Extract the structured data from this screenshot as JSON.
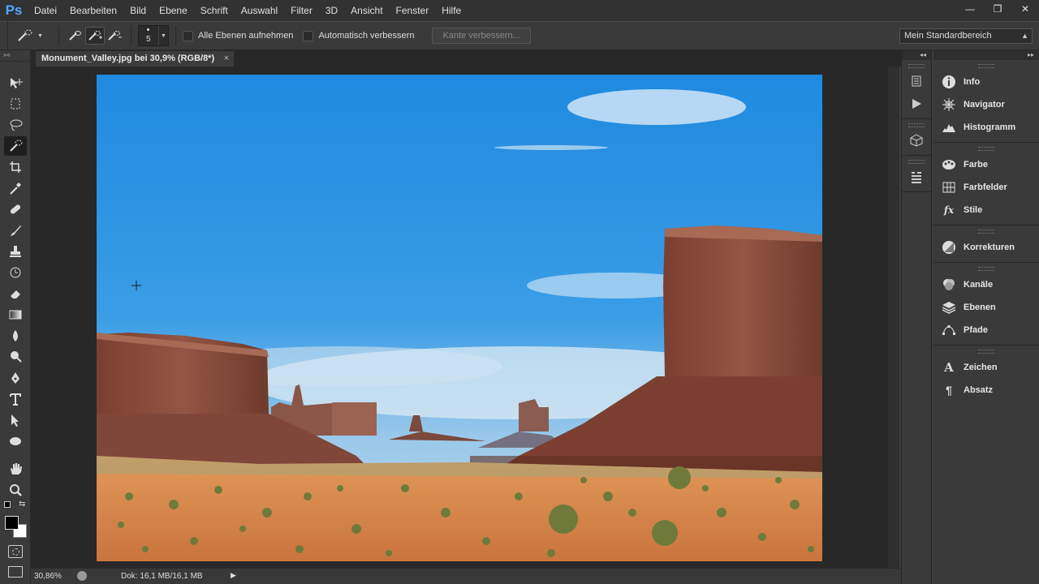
{
  "app": {
    "logo": "Ps"
  },
  "menu": [
    "Datei",
    "Bearbeiten",
    "Bild",
    "Ebene",
    "Schrift",
    "Auswahl",
    "Filter",
    "3D",
    "Ansicht",
    "Fenster",
    "Hilfe"
  ],
  "window_controls": {
    "minimize": "—",
    "restore": "❐",
    "close": "✕"
  },
  "options": {
    "brush_size": "5",
    "sample_all_layers_label": "Alle Ebenen aufnehmen",
    "auto_enhance_label": "Automatisch verbessern",
    "refine_edge_label": "Kante verbessern...",
    "workspace": "Mein Standardbereich"
  },
  "document": {
    "tab_title": "Monument_Valley.jpg bei 30,9% (RGB/8*)",
    "close_glyph": "×"
  },
  "status": {
    "zoom": "30,86%",
    "doc_info": "Dok: 16,1 MB/16,1 MB"
  },
  "toolbar": {
    "collapse_glyph": "»«",
    "tools": [
      "move-tool",
      "marquee-tool",
      "lasso-tool",
      "quick-selection-tool",
      "crop-tool",
      "eyedropper-tool",
      "healing-brush-tool",
      "brush-tool",
      "clone-stamp-tool",
      "history-brush-tool",
      "eraser-tool",
      "gradient-tool",
      "blur-tool",
      "dodge-tool",
      "pen-tool",
      "type-tool",
      "path-selection-tool",
      "shape-tool",
      "hand-tool",
      "zoom-tool"
    ],
    "active_tool": "quick-selection-tool"
  },
  "panels": {
    "group1": [
      {
        "label": "Info",
        "icon": "info-icon"
      },
      {
        "label": "Navigator",
        "icon": "navigator-icon"
      },
      {
        "label": "Histogramm",
        "icon": "histogram-icon"
      }
    ],
    "group2": [
      {
        "label": "Farbe",
        "icon": "color-palette-icon"
      },
      {
        "label": "Farbfelder",
        "icon": "swatches-icon"
      },
      {
        "label": "Stile",
        "icon": "styles-icon"
      }
    ],
    "group3": [
      {
        "label": "Korrekturen",
        "icon": "adjustments-icon"
      }
    ],
    "group4": [
      {
        "label": "Kanäle",
        "icon": "channels-icon"
      },
      {
        "label": "Ebenen",
        "icon": "layers-icon"
      },
      {
        "label": "Pfade",
        "icon": "paths-icon"
      }
    ],
    "group5": [
      {
        "label": "Zeichen",
        "icon": "character-icon"
      },
      {
        "label": "Absatz",
        "icon": "paragraph-icon"
      }
    ]
  },
  "colors": {
    "accent": "#4fa8ff",
    "chrome_dark": "#282828",
    "chrome_mid": "#3a3a3a",
    "sky": "#2a8fe0",
    "rock": "#8a4b38",
    "sand": "#d9874a"
  }
}
